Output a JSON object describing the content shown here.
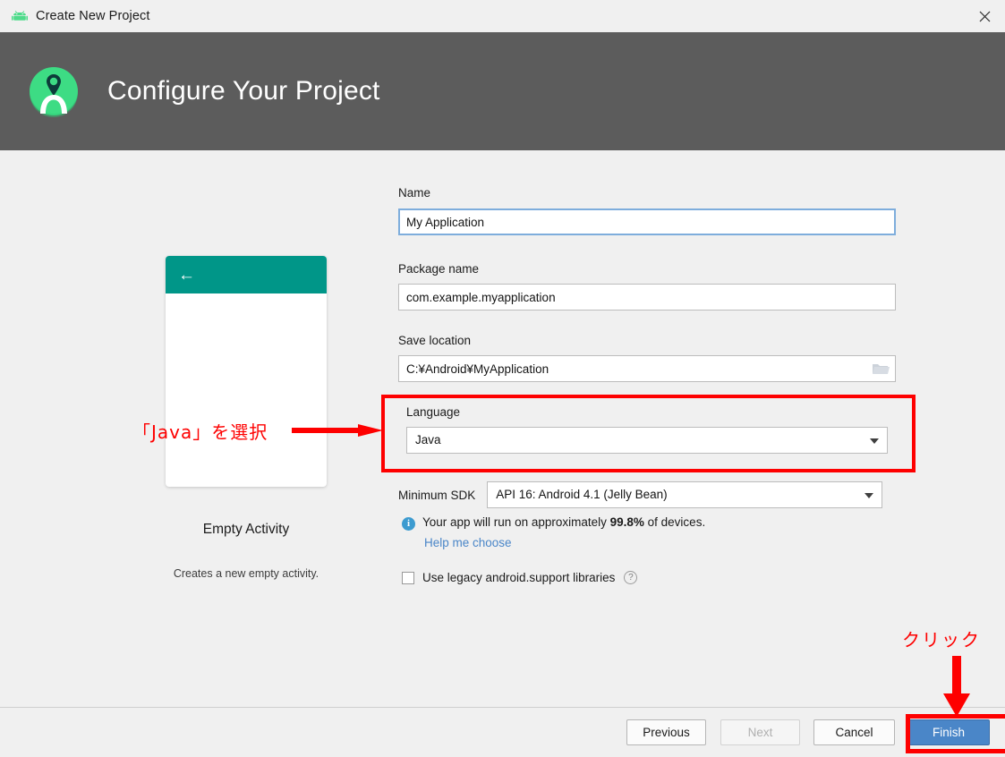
{
  "window": {
    "title": "Create New Project",
    "app_icon": "android-robot-icon",
    "close_icon": "close-icon"
  },
  "header": {
    "title": "Configure Your Project",
    "logo": "android-studio-logo",
    "background_color": "#5c5c5c"
  },
  "preview": {
    "back_icon": "back-arrow-icon",
    "appbar_color": "#009688",
    "template_name": "Empty Activity",
    "template_description": "Creates a new empty activity."
  },
  "form": {
    "name": {
      "label": "Name",
      "value": "My Application",
      "focused": true
    },
    "package_name": {
      "label": "Package name",
      "value": "com.example.myapplication"
    },
    "save_location": {
      "label": "Save location",
      "value": "C:¥Android¥MyApplication",
      "browse_icon": "folder-icon"
    },
    "language": {
      "label": "Language",
      "value": "Java",
      "dropdown_icon": "chevron-down-icon"
    },
    "minimum_sdk": {
      "label": "Minimum SDK",
      "value": "API 16: Android 4.1 (Jelly Bean)",
      "dropdown_icon": "chevron-down-icon"
    },
    "device_info": {
      "icon": "info-icon",
      "text_before": "Your app will run on approximately ",
      "percent": "99.8%",
      "text_after": " of devices.",
      "help_link": "Help me choose"
    },
    "legacy_libraries": {
      "label": "Use legacy android.support libraries",
      "checked": false,
      "help_icon": "question-mark-icon"
    }
  },
  "footer": {
    "previous": "Previous",
    "next": "Next",
    "next_disabled": true,
    "cancel": "Cancel",
    "finish": "Finish",
    "finish_primary_color": "#4a86c8"
  },
  "annotations": {
    "color": "#fe0000",
    "select_java_text": "「Java」を選択",
    "click_text": "クリック"
  }
}
